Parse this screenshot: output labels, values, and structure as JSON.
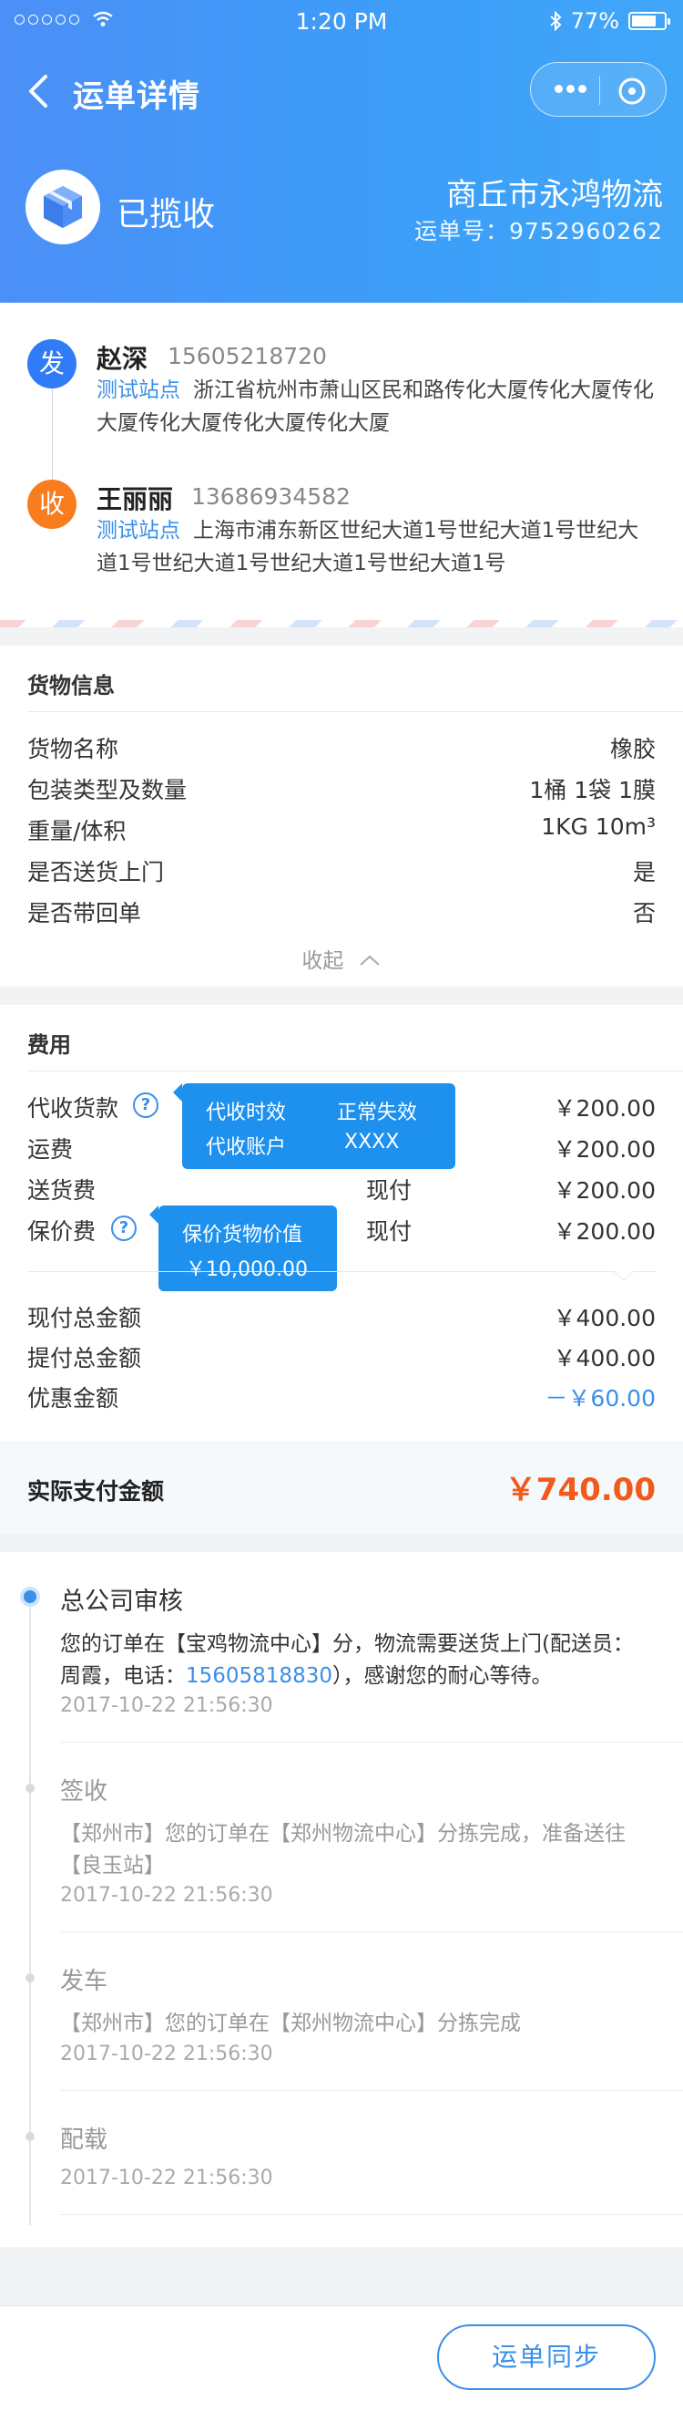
{
  "status_bar": {
    "time": "1:20 PM",
    "battery": "77%",
    "battery_level": 0.77
  },
  "nav": {
    "title": "运单详情",
    "icons": [
      "back-arrow-icon",
      "more-dots-icon",
      "close-circle-icon"
    ]
  },
  "header": {
    "status": "已揽收",
    "company": "商丘市永鸿物流",
    "waybill": "运单号：9752960262",
    "accent": "#4b8ff7"
  },
  "sender": {
    "badge": "发",
    "name": "赵深",
    "phone": "15605218720",
    "station": "测试站点",
    "address": "浙江省杭州市萧山区民和路传化大厦传化大厦传化大厦传化大厦传化大厦传化大厦"
  },
  "receiver": {
    "badge": "收",
    "name": "王丽丽",
    "phone": "13686934582",
    "station": "测试站点",
    "address": "上海市浦东新区世纪大道1号世纪大道1号世纪大道1号世纪大道1号世纪大道1号世纪大道1号"
  },
  "cargo": {
    "title": "货物信息",
    "rows": [
      {
        "label": "货物名称",
        "value": "橡胶"
      },
      {
        "label": "包装类型及数量",
        "value": "1桶  1袋  1膜"
      },
      {
        "label": "重量/体积",
        "value": "1KG  10m³"
      },
      {
        "label": "是否送货上门",
        "value": "是"
      },
      {
        "label": "是否带回单",
        "value": "否"
      }
    ],
    "collapse": "收起"
  },
  "fees": {
    "title": "费用",
    "rows": [
      {
        "label": "代收货款",
        "mid": "",
        "value": "￥200.00"
      },
      {
        "label": "运费",
        "mid": "",
        "value": "￥200.00"
      },
      {
        "label": "送货费",
        "mid": "现付",
        "value": "￥200.00"
      },
      {
        "label": "保价费",
        "mid": "现付",
        "value": "￥200.00"
      }
    ],
    "tip_cod": {
      "line1_label": "代收时效",
      "line1_value": "正常失效",
      "line2_label": "代收账户",
      "line2_value": "XXXX"
    },
    "tip_insured": {
      "line1": "保价货物价值",
      "line2": "￥10,000.00"
    },
    "totals": [
      {
        "label": "现付总金额",
        "value": "￥400.00"
      },
      {
        "label": "提付总金额",
        "value": "￥400.00"
      },
      {
        "label": "优惠金额",
        "value": "－￥60.00"
      }
    ],
    "actual_label": "实际支付金额",
    "actual_value": "￥740.00",
    "discount_color": "#3a8fe8",
    "actual_color": "#f25a1c"
  },
  "timeline": [
    {
      "status": "总公司审核",
      "msg_a": "您的订单在【宝鸡物流中心】分，物流需要送货上门(配送员：周霞，电话：",
      "phone": "15605818830",
      "msg_b": "），感谢您的耐心等待。",
      "time": "2017-10-22  21:56:30"
    },
    {
      "status": "签收",
      "msg": "【郑州市】您的订单在【郑州物流中心】分拣完成，准备送往【良玉站】",
      "time": "2017-10-22  21:56:30"
    },
    {
      "status": "发车",
      "msg": "【郑州市】您的订单在【郑州物流中心】分拣完成",
      "time": "2017-10-22  21:56:30"
    },
    {
      "status": "配载",
      "time": "2017-10-22  21:56:30"
    }
  ],
  "bottom": {
    "sync_button": "运单同步"
  }
}
